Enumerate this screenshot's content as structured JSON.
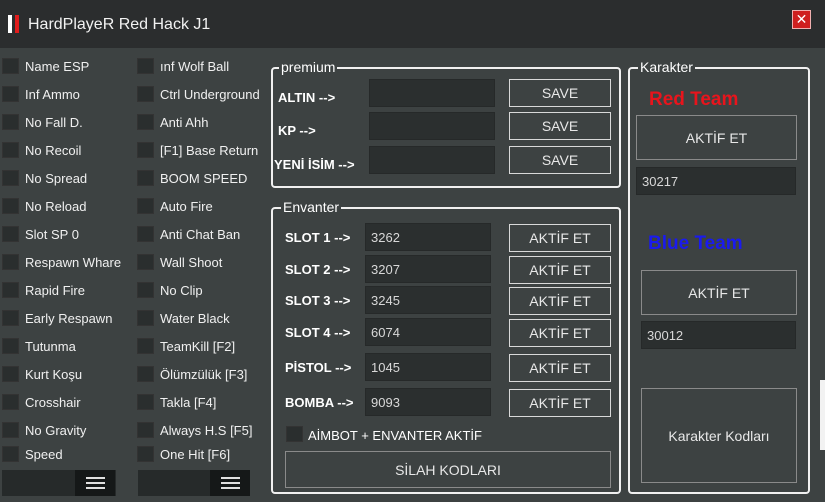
{
  "window": {
    "title": "HardPlayeR Red Hack J1",
    "close": "✕"
  },
  "col1": [
    "Name ESP",
    "Inf Ammo",
    "No Fall D.",
    "No Recoil",
    "No Spread",
    "No Reload",
    "Slot SP 0",
    "Respawn Whare",
    "Rapid Fire",
    "Early Respawn",
    "Tutunma",
    "Kurt Koşu",
    "Crosshair",
    "No Gravity",
    "Speed"
  ],
  "col2": [
    "ınf Wolf Ball",
    "Ctrl Underground",
    "Anti Ahh",
    "[F1] Base Return",
    "BOOM SPEED",
    "Auto Fire",
    "Anti Chat Ban",
    "Wall Shoot",
    "No Clip",
    "Water Black",
    "TeamKill [F2]",
    "Ölümzülük [F3]",
    "Takla [F4]",
    "Always H.S [F5]",
    "One Hit [F6]"
  ],
  "premium": {
    "legend": "premium",
    "rows": [
      {
        "label": "ALTIN -->",
        "value": "",
        "button": "SAVE"
      },
      {
        "label": "KP -->",
        "value": "",
        "button": "SAVE"
      },
      {
        "label": "YENİ İSİM  -->",
        "value": "",
        "button": "SAVE"
      }
    ]
  },
  "envanter": {
    "legend": "Envanter",
    "rows": [
      {
        "label": "SLOT 1  -->",
        "value": "3262",
        "button": "AKTİF ET"
      },
      {
        "label": "SLOT 2  -->",
        "value": "3207",
        "button": "AKTİF ET"
      },
      {
        "label": "SLOT 3  -->",
        "value": "3245",
        "button": "AKTİF ET"
      },
      {
        "label": "SLOT 4  -->",
        "value": "6074",
        "button": "AKTİF ET"
      },
      {
        "label": "PİSTOL  -->",
        "value": "1045",
        "button": "AKTİF ET"
      },
      {
        "label": "BOMBA  -->",
        "value": "9093",
        "button": "AKTİF ET"
      }
    ],
    "aimbot": "AİMBOT + ENVANTER AKTİF",
    "silah": "SİLAH KODLARI"
  },
  "karakter": {
    "legend": "Karakter",
    "red_team": "Red Team",
    "red_button": "AKTİF ET",
    "red_value": "30217",
    "blue_team": "Blue Team",
    "blue_button": "AKTİF ET",
    "blue_value": "30012",
    "codes_button": "Karakter Kodları"
  },
  "colors": {
    "red_team": "#e8141c",
    "blue_team": "#1a1aee",
    "close": "#cf1f1f"
  },
  "icons": {
    "close": "close-icon",
    "menu": "hamburger-menu-icon"
  }
}
